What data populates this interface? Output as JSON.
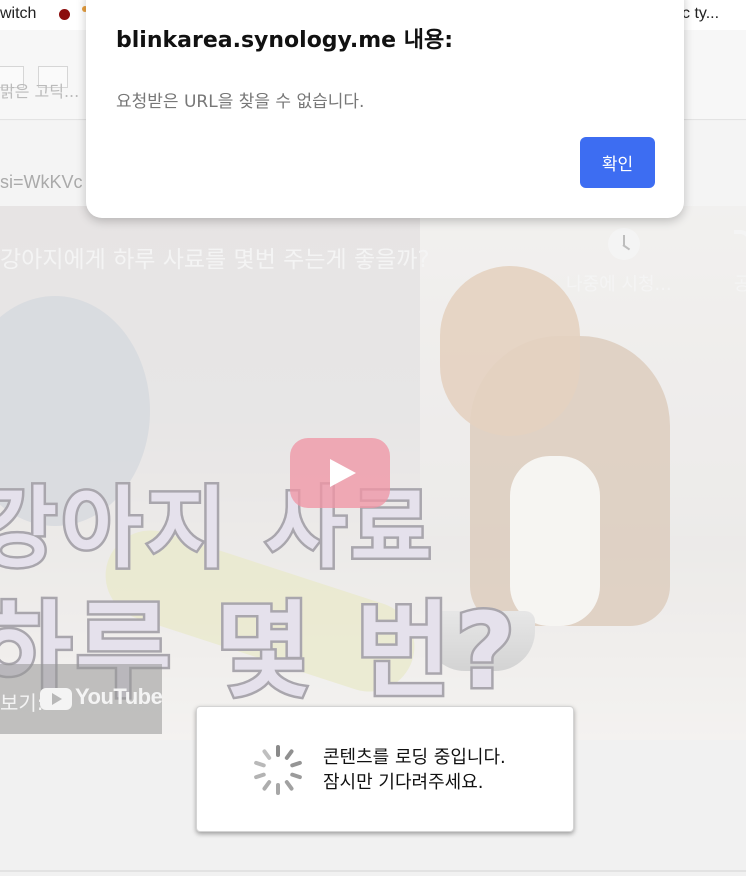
{
  "bookmarks": {
    "left_label": "witch",
    "right_label": "c ty..."
  },
  "editor": {
    "font_hint": "맑은 고딕...",
    "url_fragment": "si=WkKVc"
  },
  "video": {
    "title": "강아지에게 하루 사료를 몇번 주는게 좋을까?",
    "watch_later_label": "나중에 시청...",
    "share_label": "공",
    "overlay_line1": "강아지 사료",
    "overlay_line2": "하루 몇 번?",
    "watch_on_label": "보기:",
    "youtube_label": "YouTube",
    "play_color": "#f096a5"
  },
  "dialog": {
    "title": "blinkarea.synology.me 내용:",
    "message": "요청받은 URL을 찾을 수 없습니다.",
    "ok_label": "확인",
    "accent_color": "#3d6df2"
  },
  "loading": {
    "line1": "콘텐츠를 로딩 중입니다.",
    "line2": "잠시만 기다려주세요."
  }
}
